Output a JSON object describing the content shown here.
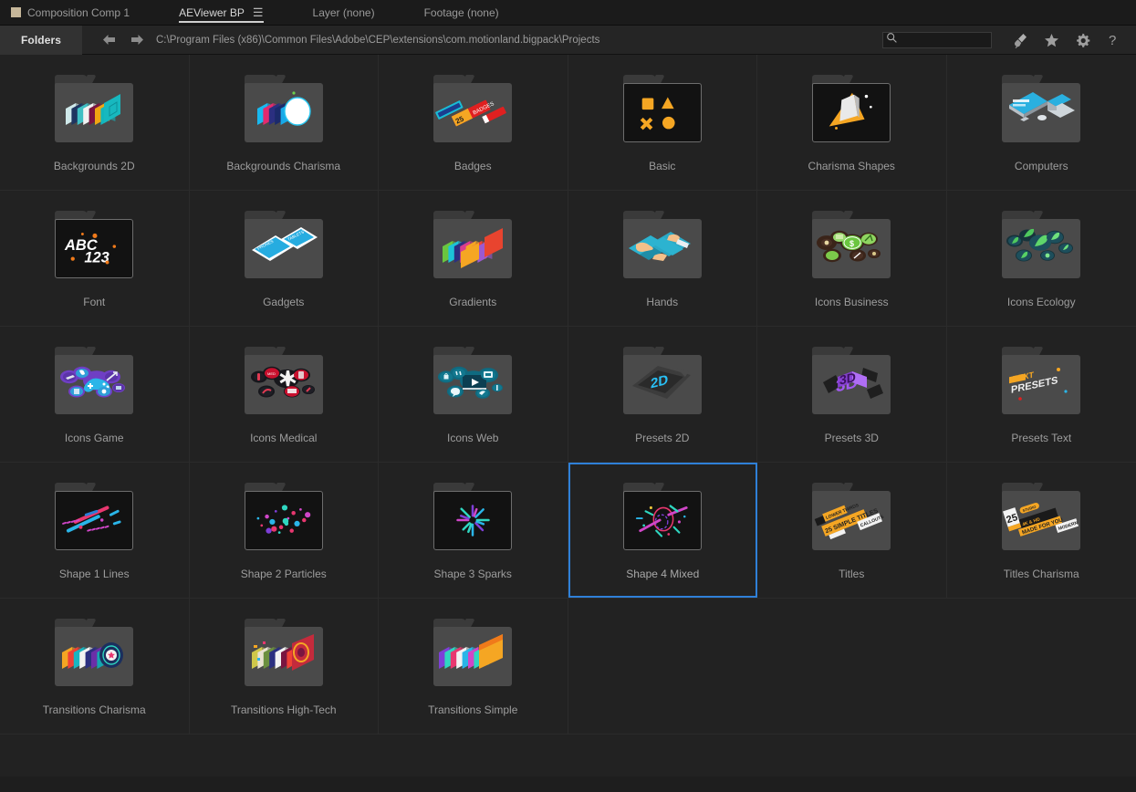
{
  "tabbar": {
    "tabs": [
      {
        "label": "Composition Comp 1",
        "active": false,
        "swatch": true,
        "menu": false
      },
      {
        "label": "AEViewer BP",
        "active": true,
        "swatch": false,
        "menu": true
      },
      {
        "label": "Layer  (none)",
        "active": false,
        "swatch": false,
        "menu": false
      },
      {
        "label": "Footage  (none)",
        "active": false,
        "swatch": false,
        "menu": false
      }
    ]
  },
  "toolbar": {
    "folders_label": "Folders",
    "back_icon": "arrow-left-icon",
    "forward_icon": "arrow-right-icon",
    "breadcrumb_path": "C:\\Program Files (x86)\\Common Files\\Adobe\\CEP\\extensions\\com.motionland.bigpack\\Projects",
    "search_value": "",
    "search_placeholder": "",
    "search_icon": "search-icon",
    "icons": [
      {
        "name": "flash-icon",
        "glyph": "flash"
      },
      {
        "name": "star-icon",
        "glyph": "star"
      },
      {
        "name": "gear-icon",
        "glyph": "gear"
      },
      {
        "name": "help-icon",
        "glyph": "?"
      }
    ]
  },
  "grid": {
    "selected_color": "#2f80d8",
    "columns": 6,
    "rows": [
      [
        {
          "label": "Backgrounds 2D",
          "thumb": "bg2d",
          "dark": false,
          "selected": false
        },
        {
          "label": "Backgrounds Charisma",
          "thumb": "bgcharisma",
          "dark": false,
          "selected": false
        },
        {
          "label": "Badges",
          "thumb": "badges",
          "dark": false,
          "selected": false
        },
        {
          "label": "Basic",
          "thumb": "basic",
          "dark": true,
          "selected": false
        },
        {
          "label": "Charisma Shapes",
          "thumb": "charshapes",
          "dark": true,
          "selected": false
        },
        {
          "label": "Computers",
          "thumb": "computers",
          "dark": false,
          "selected": false
        }
      ],
      [
        {
          "label": "Font",
          "thumb": "font",
          "dark": true,
          "selected": false
        },
        {
          "label": "Gadgets",
          "thumb": "gadgets",
          "dark": false,
          "selected": false
        },
        {
          "label": "Gradients",
          "thumb": "gradients",
          "dark": false,
          "selected": false
        },
        {
          "label": "Hands",
          "thumb": "hands",
          "dark": false,
          "selected": false
        },
        {
          "label": "Icons Business",
          "thumb": "business",
          "dark": false,
          "selected": false
        },
        {
          "label": "Icons Ecology",
          "thumb": "ecology",
          "dark": false,
          "selected": false
        }
      ],
      [
        {
          "label": "Icons Game",
          "thumb": "game",
          "dark": false,
          "selected": false
        },
        {
          "label": "Icons Medical",
          "thumb": "medical",
          "dark": false,
          "selected": false
        },
        {
          "label": "Icons Web",
          "thumb": "web",
          "dark": false,
          "selected": false
        },
        {
          "label": "Presets 2D",
          "thumb": "presets2d",
          "dark": false,
          "selected": false
        },
        {
          "label": "Presets 3D",
          "thumb": "presets3d",
          "dark": false,
          "selected": false
        },
        {
          "label": "Presets Text",
          "thumb": "presetstext",
          "dark": false,
          "selected": false
        }
      ],
      [
        {
          "label": "Shape 1 Lines",
          "thumb": "lines",
          "dark": true,
          "selected": false
        },
        {
          "label": "Shape 2 Particles",
          "thumb": "particles",
          "dark": true,
          "selected": false
        },
        {
          "label": "Shape 3 Sparks",
          "thumb": "sparks",
          "dark": true,
          "selected": false
        },
        {
          "label": "Shape 4 Mixed",
          "thumb": "mixed",
          "dark": true,
          "selected": true
        },
        {
          "label": "Titles",
          "thumb": "titles",
          "dark": false,
          "selected": false
        },
        {
          "label": "Titles Charisma",
          "thumb": "titlesch",
          "dark": false,
          "selected": false
        }
      ],
      [
        {
          "label": "Transitions Charisma",
          "thumb": "transch",
          "dark": false,
          "selected": false
        },
        {
          "label": "Transitions High-Tech",
          "thumb": "transhigh",
          "dark": false,
          "selected": false
        },
        {
          "label": "Transitions Simple",
          "thumb": "transsimple",
          "dark": false,
          "selected": false
        },
        {
          "label": "",
          "thumb": "",
          "dark": false,
          "selected": false,
          "empty": true
        },
        {
          "label": "",
          "thumb": "",
          "dark": false,
          "selected": false,
          "empty": true
        },
        {
          "label": "",
          "thumb": "",
          "dark": false,
          "selected": false,
          "empty": true
        }
      ]
    ]
  }
}
